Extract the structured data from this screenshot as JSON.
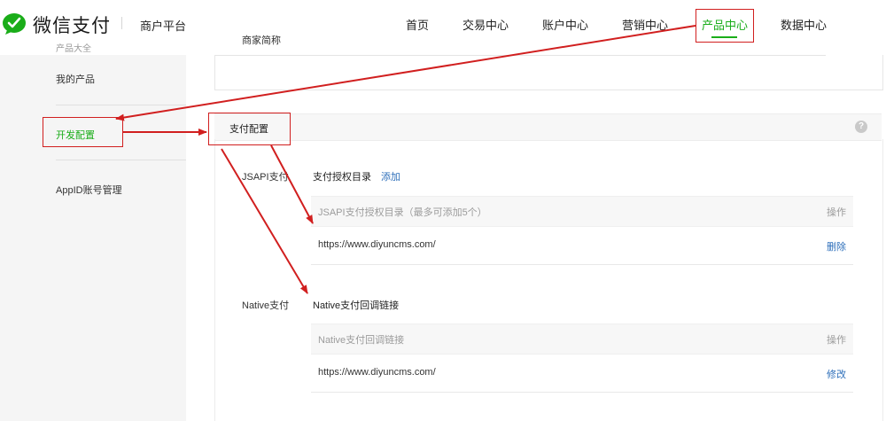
{
  "header": {
    "brand": "微信支付",
    "platform": "商户平台",
    "merchant_name": "商家简称",
    "nav": [
      "首页",
      "交易中心",
      "账户中心",
      "营销中心",
      "产品中心",
      "数据中心"
    ],
    "active_nav": "产品中心",
    "accent_color": "#1aad19"
  },
  "sidebar": {
    "category": "产品大全",
    "items": [
      "我的产品",
      "开发配置",
      "AppID账号管理"
    ],
    "active_item": "开发配置"
  },
  "section": {
    "title": "支付配置",
    "help_icon": "question-icon",
    "jsapi": {
      "label": "JSAPI支付",
      "sub_title": "支付授权目录",
      "add_link": "添加",
      "table_header": "JSAPI支付授权目录（最多可添加5个）",
      "action_header": "操作",
      "row_value": "https://www.diyuncms.com/",
      "row_action": "删除"
    },
    "native": {
      "label": "Native支付",
      "sub_title": "Native支付回调链接",
      "table_header": "Native支付回调链接",
      "action_header": "操作",
      "row_value": "https://www.diyuncms.com/",
      "row_action": "修改"
    }
  },
  "annotation_color": "#d11f1f"
}
